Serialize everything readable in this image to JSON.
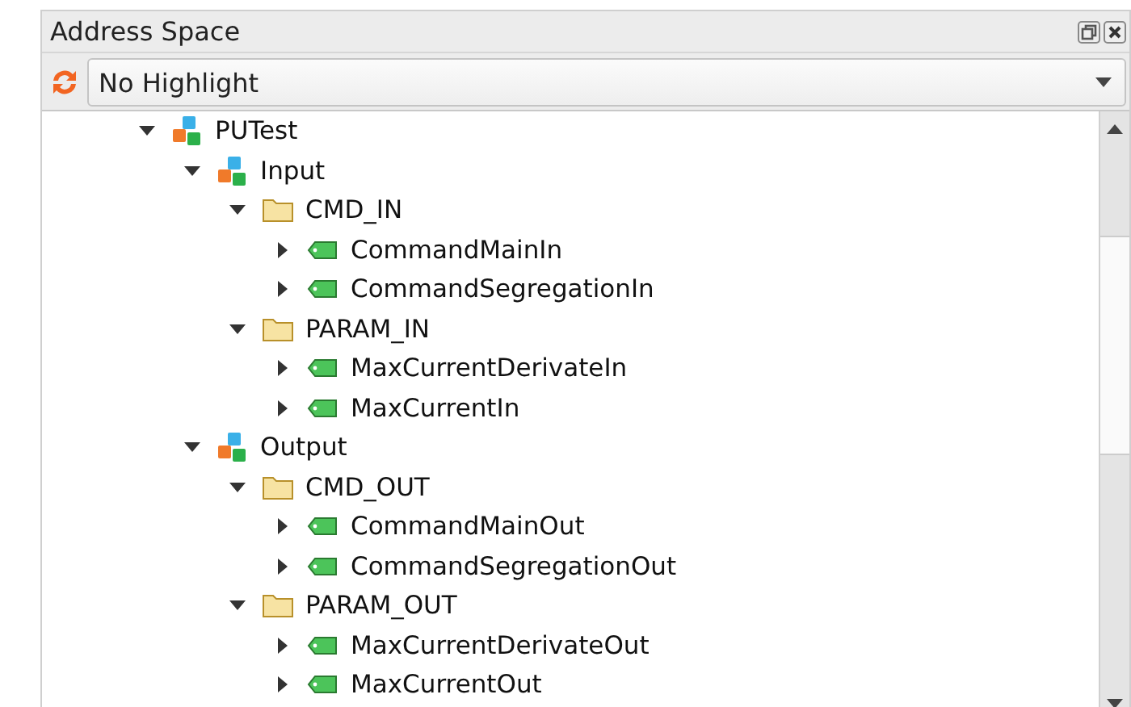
{
  "panel": {
    "title": "Address Space"
  },
  "highlight": {
    "value": "No Highlight"
  },
  "tree": [
    {
      "label": "PUTest",
      "kind": "object",
      "expanded": true,
      "children": [
        {
          "label": "Input",
          "kind": "object",
          "expanded": true,
          "children": [
            {
              "label": "CMD_IN",
              "kind": "folder",
              "expanded": true,
              "children": [
                {
                  "label": "CommandMainIn",
                  "kind": "variable",
                  "expanded": false
                },
                {
                  "label": "CommandSegregationIn",
                  "kind": "variable",
                  "expanded": false
                }
              ]
            },
            {
              "label": "PARAM_IN",
              "kind": "folder",
              "expanded": true,
              "children": [
                {
                  "label": "MaxCurrentDerivateIn",
                  "kind": "variable",
                  "expanded": false
                },
                {
                  "label": "MaxCurrentIn",
                  "kind": "variable",
                  "expanded": false
                }
              ]
            }
          ]
        },
        {
          "label": "Output",
          "kind": "object",
          "expanded": true,
          "children": [
            {
              "label": "CMD_OUT",
              "kind": "folder",
              "expanded": true,
              "children": [
                {
                  "label": "CommandMainOut",
                  "kind": "variable",
                  "expanded": false
                },
                {
                  "label": "CommandSegregationOut",
                  "kind": "variable",
                  "expanded": false
                }
              ]
            },
            {
              "label": "PARAM_OUT",
              "kind": "folder",
              "expanded": true,
              "children": [
                {
                  "label": "MaxCurrentDerivateOut",
                  "kind": "variable",
                  "expanded": false
                },
                {
                  "label": "MaxCurrentOut",
                  "kind": "variable",
                  "expanded": false
                }
              ]
            }
          ]
        }
      ]
    }
  ]
}
